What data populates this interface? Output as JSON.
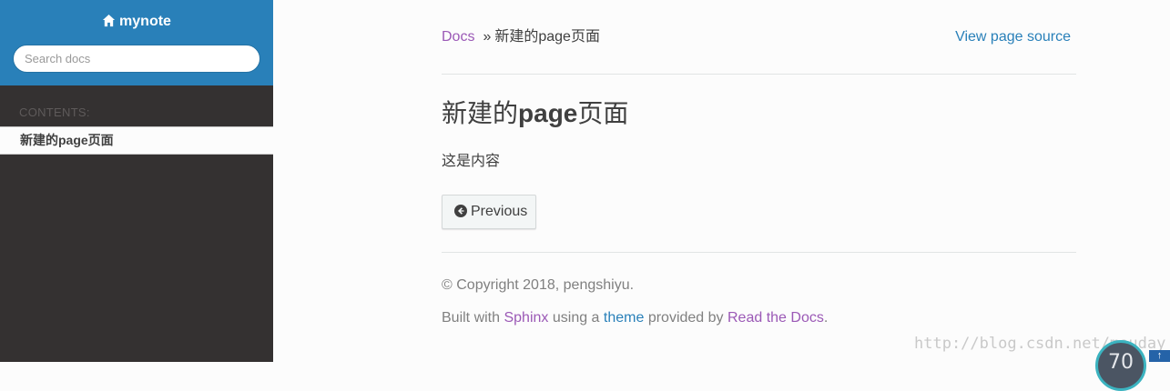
{
  "sidebar": {
    "brand": "mynote",
    "search_placeholder": "Search docs",
    "caption": "CONTENTS:",
    "current_item": "新建的page页面"
  },
  "breadcrumb": {
    "root": "Docs",
    "separator": "»",
    "current": "新建的page页面"
  },
  "view_source_label": "View page source",
  "page": {
    "title_prefix": "新建的",
    "title_bold": "page",
    "title_suffix": "页面",
    "body": "这是内容"
  },
  "nav": {
    "previous_label": "Previous"
  },
  "footer": {
    "copyright": "© Copyright 2018, pengshiyu.",
    "built_with": "Built with",
    "sphinx": "Sphinx",
    "using_a": "using a",
    "theme": "theme",
    "provided_by": "provided by",
    "rtd": "Read the Docs",
    "period": "."
  },
  "overlay": {
    "watermark": "http://blog.csdn.net/mouday",
    "widget_value": "70",
    "widget_arrow": "↑"
  },
  "colors": {
    "sidebar_top": "#2980b9",
    "sidebar_bg": "#343131",
    "link_purple": "#9b59b6",
    "link_blue": "#2980b9"
  }
}
